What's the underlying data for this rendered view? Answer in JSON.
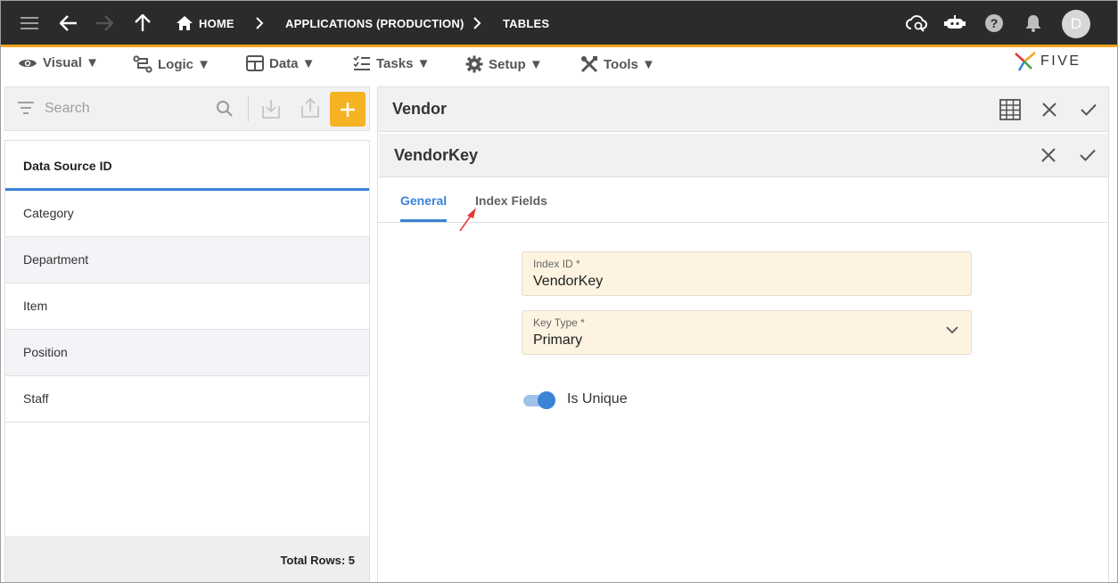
{
  "topbar": {
    "breadcrumbs": [
      "HOME",
      "APPLICATIONS (PRODUCTION)",
      "TABLES"
    ],
    "avatar_initial": "D",
    "accent": "#f5a623"
  },
  "menu": {
    "items": [
      "Visual ▼",
      "Logic ▼",
      "Data ▼",
      "Tasks ▼",
      "Setup ▼",
      "Tools ▼"
    ]
  },
  "logo": {
    "text": "FIVE"
  },
  "search": {
    "placeholder": "Search"
  },
  "list": {
    "header": "Data Source ID",
    "rows": [
      "Category",
      "Department",
      "Item",
      "Position",
      "Staff"
    ],
    "footer": "Total Rows: 5"
  },
  "record": {
    "title": "Vendor",
    "sub_title": "VendorKey",
    "tabs": [
      "General",
      "Index Fields"
    ]
  },
  "form": {
    "index_id_label": "Index ID *",
    "index_id_value": "VendorKey",
    "key_type_label": "Key Type *",
    "key_type_value": "Primary",
    "is_unique_label": "Is Unique",
    "is_unique_on": true
  },
  "colors": {
    "primary": "#3b83d6",
    "add_button": "#f5b324",
    "field_bg": "#fdf3e0",
    "annotation": "#e53935"
  }
}
